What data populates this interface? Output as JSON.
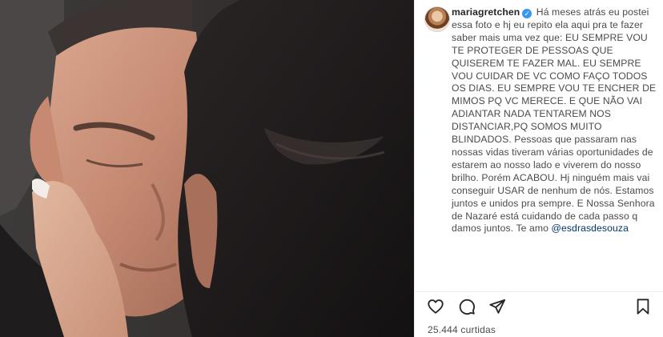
{
  "post": {
    "username": "mariagretchen",
    "caption": "Há meses atrás eu postei essa foto e hj eu repito ela aqui pra te fazer saber mais uma vez que: EU SEMPRE VOU TE PROTEGER DE PESSOAS QUE QUISEREM TE FAZER MAL. EU SEMPRE VOU CUIDAR DE VC COMO FAÇO TODOS OS DIAS. EU SEMPRE VOU TE ENCHER DE MIMOS PQ VC MERECE. E QUE NÃO VAI ADIANTAR NADA TENTAREM NOS DISTANCIAR,PQ SOMOS MUITO BLINDADOS. Pessoas que passaram nas nossas vidas tiveram várias oportunidades de estarem ao nosso lado e viverem do nosso brilho. Porém ACABOU. Hj ninguém mais vai conseguir USAR de nenhum de nós. Estamos juntos e unidos pra sempre. E Nossa Senhora de Nazaré está cuidando de cada passo q damos juntos. Te amo",
    "mention": "@esdrasdesouza",
    "likes": "25.444 curtidas"
  },
  "icons": {
    "verified": "verified-badge-icon",
    "like": "heart-icon",
    "comment": "comment-bubble-icon",
    "share": "paper-plane-icon",
    "save": "bookmark-icon"
  },
  "colors": {
    "verified": "#3897f0",
    "mention": "#00376b",
    "text": "#262626"
  }
}
